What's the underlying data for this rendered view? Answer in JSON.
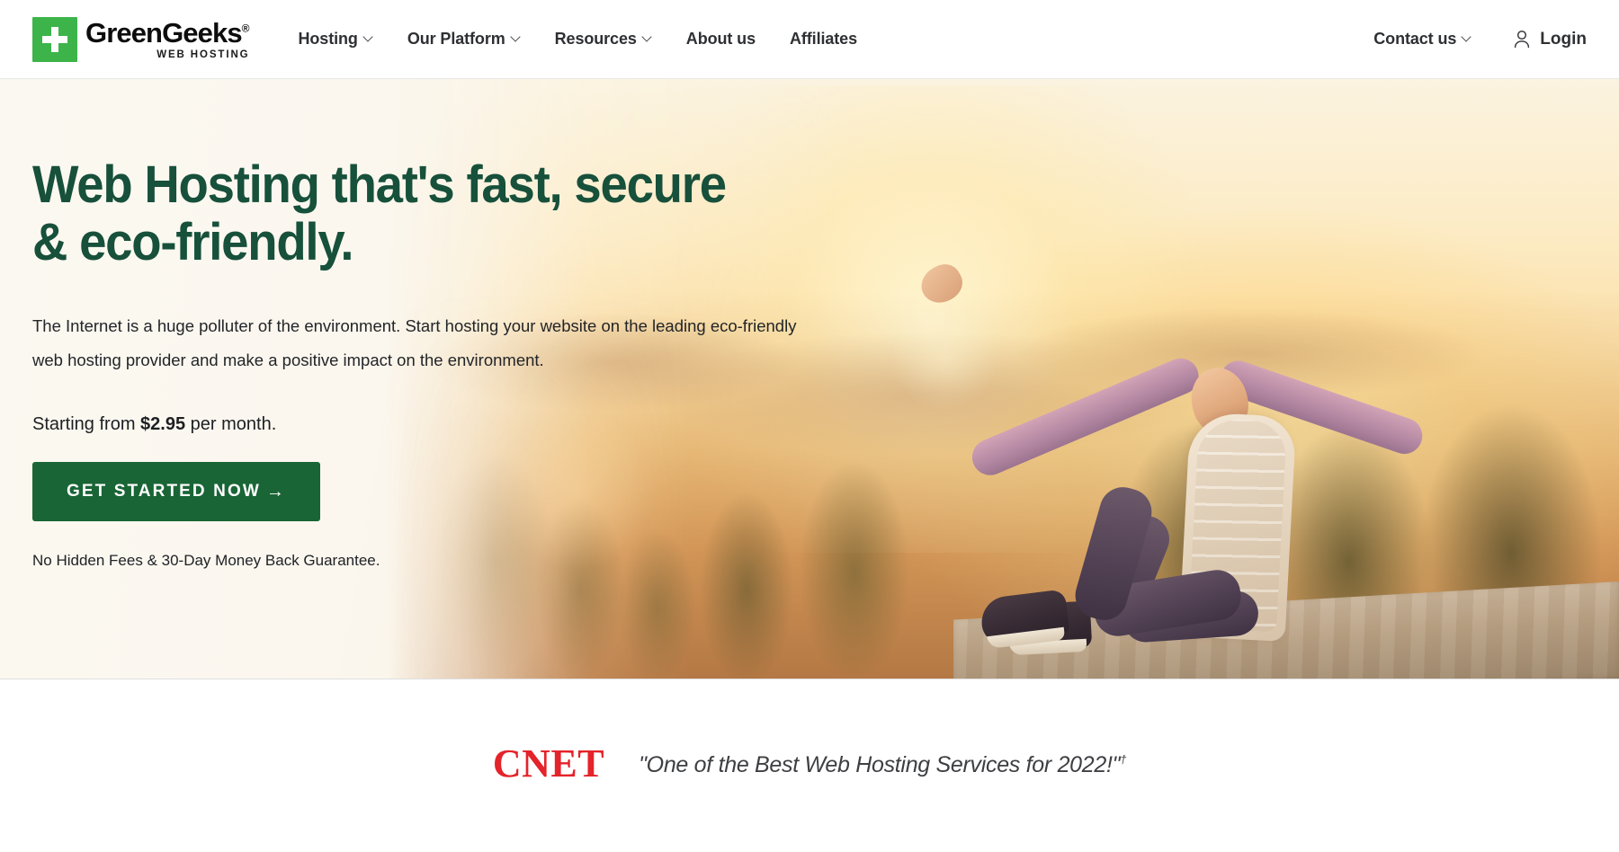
{
  "brand": {
    "name": "GreenGeeks",
    "registered_mark": "®",
    "tagline": "WEB HOSTING",
    "logo_icon": "green-plus-logo-icon",
    "accent_green": "#3cb44a",
    "dark_green": "#196535",
    "title_green": "#17503b"
  },
  "header": {
    "nav": [
      {
        "label": "Hosting",
        "has_dropdown": true
      },
      {
        "label": "Our Platform",
        "has_dropdown": true
      },
      {
        "label": "Resources",
        "has_dropdown": true
      },
      {
        "label": "About us",
        "has_dropdown": false
      },
      {
        "label": "Affiliates",
        "has_dropdown": false
      }
    ],
    "contact": {
      "label": "Contact us",
      "has_dropdown": true
    },
    "login": {
      "label": "Login",
      "icon": "user-icon"
    }
  },
  "hero": {
    "title": "Web Hosting that's fast, secure\n& eco-friendly.",
    "subtitle": "The Internet is a huge polluter of the environment. Start hosting your website on the leading eco-friendly web hosting provider and make a positive impact on the environment.",
    "price_prefix": "Starting from ",
    "price_value": "$2.95",
    "price_suffix": " per month.",
    "cta_label": "GET STARTED NOW",
    "cta_arrow": "→",
    "note": "No Hidden Fees & 30-Day Money Back Guarantee."
  },
  "press": {
    "logo_text": "CNET",
    "logo_color": "#e4232a",
    "quote": "\"One of the Best Web Hosting Services for 2022!\"",
    "footnote_marker": "†"
  }
}
